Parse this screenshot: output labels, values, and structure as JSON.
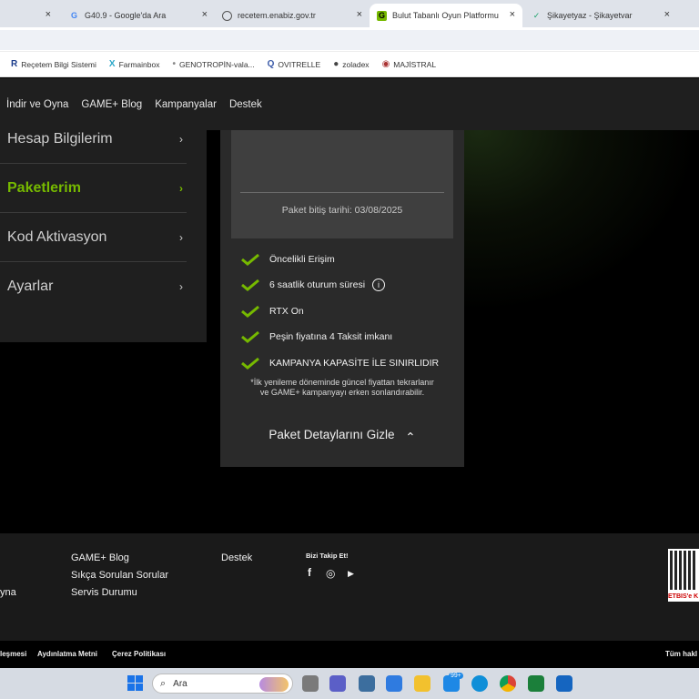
{
  "browser": {
    "tabs": [
      {
        "title": "",
        "active": false
      },
      {
        "title": "G40.9 - Google'da Ara",
        "active": false
      },
      {
        "title": "recetem.enabiz.gov.tr",
        "active": false
      },
      {
        "title": "Bulut Tabanlı Oyun Platformu -",
        "active": true
      },
      {
        "title": "Şikayetyaz - Şikayetvar",
        "active": false
      }
    ],
    "close_glyph": "×",
    "bookmarks": [
      {
        "label": "Reçetem Bilgi Sistemi",
        "icon": "R"
      },
      {
        "label": "Farmainbox",
        "icon": "X"
      },
      {
        "label": "GENOTROPİN-vala...",
        "icon": "•"
      },
      {
        "label": "OVITRELLE",
        "icon": "Q"
      },
      {
        "label": "zoladex",
        "icon": "●"
      },
      {
        "label": "MAJİSTRAL",
        "icon": "◉"
      }
    ]
  },
  "site_nav": [
    "İndir ve Oyna",
    "GAME+ Blog",
    "Kampanyalar",
    "Destek"
  ],
  "account_menu": {
    "items": [
      {
        "label": "Hesap Bilgilerim",
        "active": false
      },
      {
        "label": "Paketlerim",
        "active": true
      },
      {
        "label": "Kod Aktivasyon",
        "active": false
      },
      {
        "label": "Ayarlar",
        "active": false
      }
    ],
    "chevron": "›"
  },
  "package_card": {
    "expiry_text": "Paket bitiş tarihi: 03/08/2025",
    "features": [
      "Öncelikli Erişim",
      "6 saatlik oturum süresi",
      "RTX On",
      "Peşin fiyatına 4 Taksit imkanı",
      "KAMPANYA KAPASİTE İLE SINIRLIDIR"
    ],
    "info_glyph": "i",
    "note": "*İlk yenileme döneminde güncel fiyattan tekrarlanır ve GAME+ kampanyayı erken sonlandırabilir.",
    "toggle_label": "Paket Detaylarını Gizle",
    "toggle_glyph": "⌃"
  },
  "footer": {
    "col0": [
      "yna"
    ],
    "col1": [
      "GAME+ Blog",
      "Sıkça Sorulan Sorular",
      "Servis Durumu"
    ],
    "col2": [
      "Destek"
    ],
    "social_title": "Bizi Takip Et!",
    "social_icons": [
      "f",
      "◎",
      "▶"
    ],
    "etbis_text": "ETBİS'e K",
    "bottom_links": [
      "leşmesi",
      "Aydınlatma Metni",
      "Çerez Politikası"
    ],
    "rights": "Tüm hakl"
  },
  "taskbar": {
    "search_placeholder": "Ara",
    "badge": "99+"
  },
  "colors": {
    "accent": "#76b900",
    "panel": "#1f1f1f",
    "card": "#2a2a2a"
  }
}
